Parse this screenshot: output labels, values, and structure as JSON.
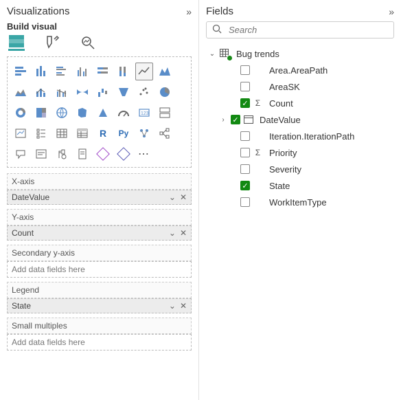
{
  "viz": {
    "title": "Visualizations",
    "subtitle": "Build visual",
    "wells": {
      "xaxis": {
        "label": "X-axis",
        "value": "DateValue"
      },
      "yaxis": {
        "label": "Y-axis",
        "value": "Count"
      },
      "secondary": {
        "label": "Secondary y-axis",
        "placeholder": "Add data fields here"
      },
      "legend": {
        "label": "Legend",
        "value": "State"
      },
      "smallmult": {
        "label": "Small multiples",
        "placeholder": "Add data fields here"
      }
    }
  },
  "fields": {
    "title": "Fields",
    "search_placeholder": "Search",
    "table": "Bug trends",
    "items": [
      {
        "name": "Area.AreaPath",
        "checked": false,
        "icon": ""
      },
      {
        "name": "AreaSK",
        "checked": false,
        "icon": ""
      },
      {
        "name": "Count",
        "checked": true,
        "icon": "sigma"
      },
      {
        "name": "DateValue",
        "checked": true,
        "icon": "calendar",
        "expandable": true
      },
      {
        "name": "Iteration.IterationPath",
        "checked": false,
        "icon": ""
      },
      {
        "name": "Priority",
        "checked": false,
        "icon": "sigma"
      },
      {
        "name": "Severity",
        "checked": false,
        "icon": ""
      },
      {
        "name": "State",
        "checked": true,
        "icon": ""
      },
      {
        "name": "WorkItemType",
        "checked": false,
        "icon": ""
      }
    ]
  }
}
